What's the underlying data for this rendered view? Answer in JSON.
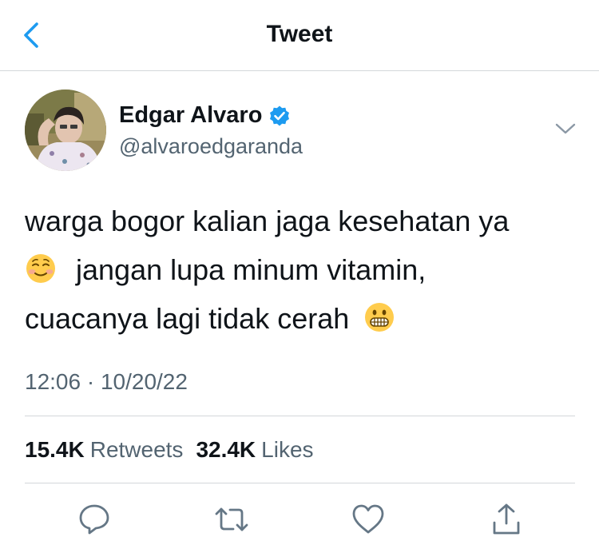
{
  "nav": {
    "title": "Tweet",
    "back_icon": "chevron-left-icon"
  },
  "user": {
    "display_name": "Edgar Alvaro",
    "handle": "@alvaroedgaranda",
    "verified_icon": "verified-badge-icon"
  },
  "tweet": {
    "line1": "warga bogor kalian jaga kesehatan ya",
    "line2": "jangan lupa minum vitamin,",
    "line3": "cuacanya lagi tidak cerah",
    "emoji1": "smiling-face-icon",
    "emoji2": "grimacing-face-icon",
    "timestamp": "12:06 · 10/20/22"
  },
  "stats": {
    "retweets_count": "15.4K",
    "retweets_label": "Retweets",
    "likes_count": "32.4K",
    "likes_label": "Likes"
  },
  "actions": [
    "reply-icon",
    "retweet-icon",
    "like-icon",
    "share-icon"
  ],
  "colors": {
    "accent": "#1d9bf0",
    "text": "#0f1419",
    "secondary": "#536471",
    "divider": "#d4d7da"
  }
}
